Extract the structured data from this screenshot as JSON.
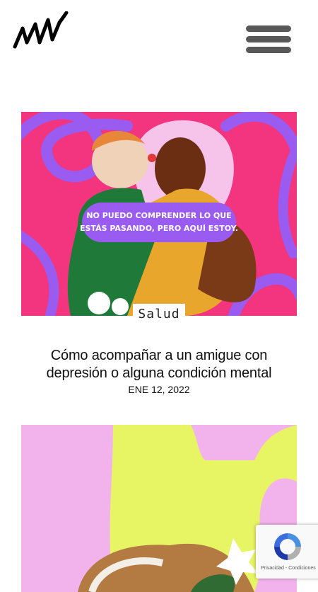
{
  "header": {
    "logo_alt": "logo",
    "menu_label": "menu"
  },
  "posts": [
    {
      "image_text": [
        "NO PUEDO COMPRENDER LO QUE",
        "ESTÁS PASANDO, PERO AQUÍ ESTOY."
      ],
      "category": "Salud",
      "title": "Cómo acompañar a un amigue con depresión o alguna condición mental",
      "date": "ENE 12, 2022"
    },
    {
      "image_text": [],
      "category": "",
      "title": "",
      "date": ""
    }
  ],
  "recaptcha": {
    "privacy_label": "Privacidad",
    "separator": "-",
    "terms_label": "Condiciones"
  },
  "colors": {
    "card1_bg": "#f2357e",
    "card1_purple": "#9a5bf0",
    "card2_pink": "#f2b3ec",
    "card2_lime": "#e7f464",
    "menu_bars": "#585858"
  }
}
